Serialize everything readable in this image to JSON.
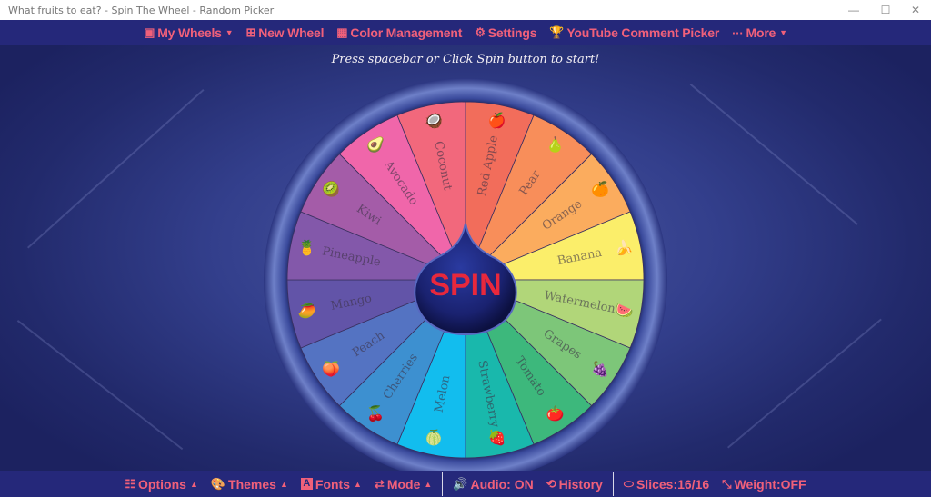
{
  "window": {
    "title": "What fruits to eat? - Spin The Wheel - Random Picker",
    "controls": {
      "minimize": "—",
      "maximize": "☐",
      "close": "✕"
    }
  },
  "topnav": {
    "items": [
      {
        "label": "My Wheels",
        "icon": "images-icon",
        "glyph": "▣",
        "caret": true
      },
      {
        "label": "New Wheel",
        "icon": "plus-square-icon",
        "glyph": "⊞",
        "caret": false
      },
      {
        "label": "Color Management",
        "icon": "palette-grid-icon",
        "glyph": "▦",
        "caret": false
      },
      {
        "label": "Settings",
        "icon": "gear-icon",
        "glyph": "⚙",
        "caret": false
      },
      {
        "label": "YouTube Comment Picker",
        "icon": "trophy-icon",
        "glyph": "🏆",
        "caret": false
      },
      {
        "label": "More",
        "icon": "ellipsis-icon",
        "glyph": "···",
        "caret": true
      }
    ],
    "caret_glyph": "▼"
  },
  "instruction": "Press spacebar or Click Spin button to start!",
  "wheel": {
    "title": "What fruits to eat?",
    "spin_label": "SPIN",
    "slices": [
      {
        "label": "Red Apple",
        "color": "#f26d5b",
        "emoji": "🍎"
      },
      {
        "label": "Pear",
        "color": "#f88e5a",
        "emoji": "🍐"
      },
      {
        "label": "Orange",
        "color": "#fbac5e",
        "emoji": "🍊"
      },
      {
        "label": "Banana",
        "color": "#fbee6a",
        "emoji": "🍌"
      },
      {
        "label": "Watermelon",
        "color": "#b1d679",
        "emoji": "🍉"
      },
      {
        "label": "Grapes",
        "color": "#7dc679",
        "emoji": "🍇"
      },
      {
        "label": "Tomato",
        "color": "#3db87c",
        "emoji": "🍅"
      },
      {
        "label": "Strawberry",
        "color": "#19b8ac",
        "emoji": "🍓"
      },
      {
        "label": "Melon",
        "color": "#12bdee",
        "emoji": "🍈"
      },
      {
        "label": "Cherries",
        "color": "#3d90d0",
        "emoji": "🍒"
      },
      {
        "label": "Peach",
        "color": "#5473c2",
        "emoji": "🍑"
      },
      {
        "label": "Mango",
        "color": "#6254a8",
        "emoji": "🥭"
      },
      {
        "label": "Pineapple",
        "color": "#8358aa",
        "emoji": "🍍"
      },
      {
        "label": "Kiwi",
        "color": "#a45ca8",
        "emoji": "🥝"
      },
      {
        "label": "Avocado",
        "color": "#f066aa",
        "emoji": "🥑"
      },
      {
        "label": "Coconut",
        "color": "#f2687c",
        "emoji": "🥥"
      }
    ]
  },
  "bottombar": {
    "options": {
      "label": "Options",
      "glyph": "☷"
    },
    "themes": {
      "label": "Themes",
      "glyph": "🎨"
    },
    "fonts": {
      "label": "Fonts",
      "glyph": "A"
    },
    "mode": {
      "label": "Mode",
      "glyph": "⇄"
    },
    "audio": {
      "label": "Audio: ON",
      "glyph": "🔊"
    },
    "history": {
      "label": "History",
      "glyph": "⟲"
    },
    "slices": {
      "label": "Slices:16/16",
      "glyph": "⬭"
    },
    "weight": {
      "label": "Weight:OFF",
      "glyph": "⤡"
    },
    "caret_glyph": "▲"
  }
}
